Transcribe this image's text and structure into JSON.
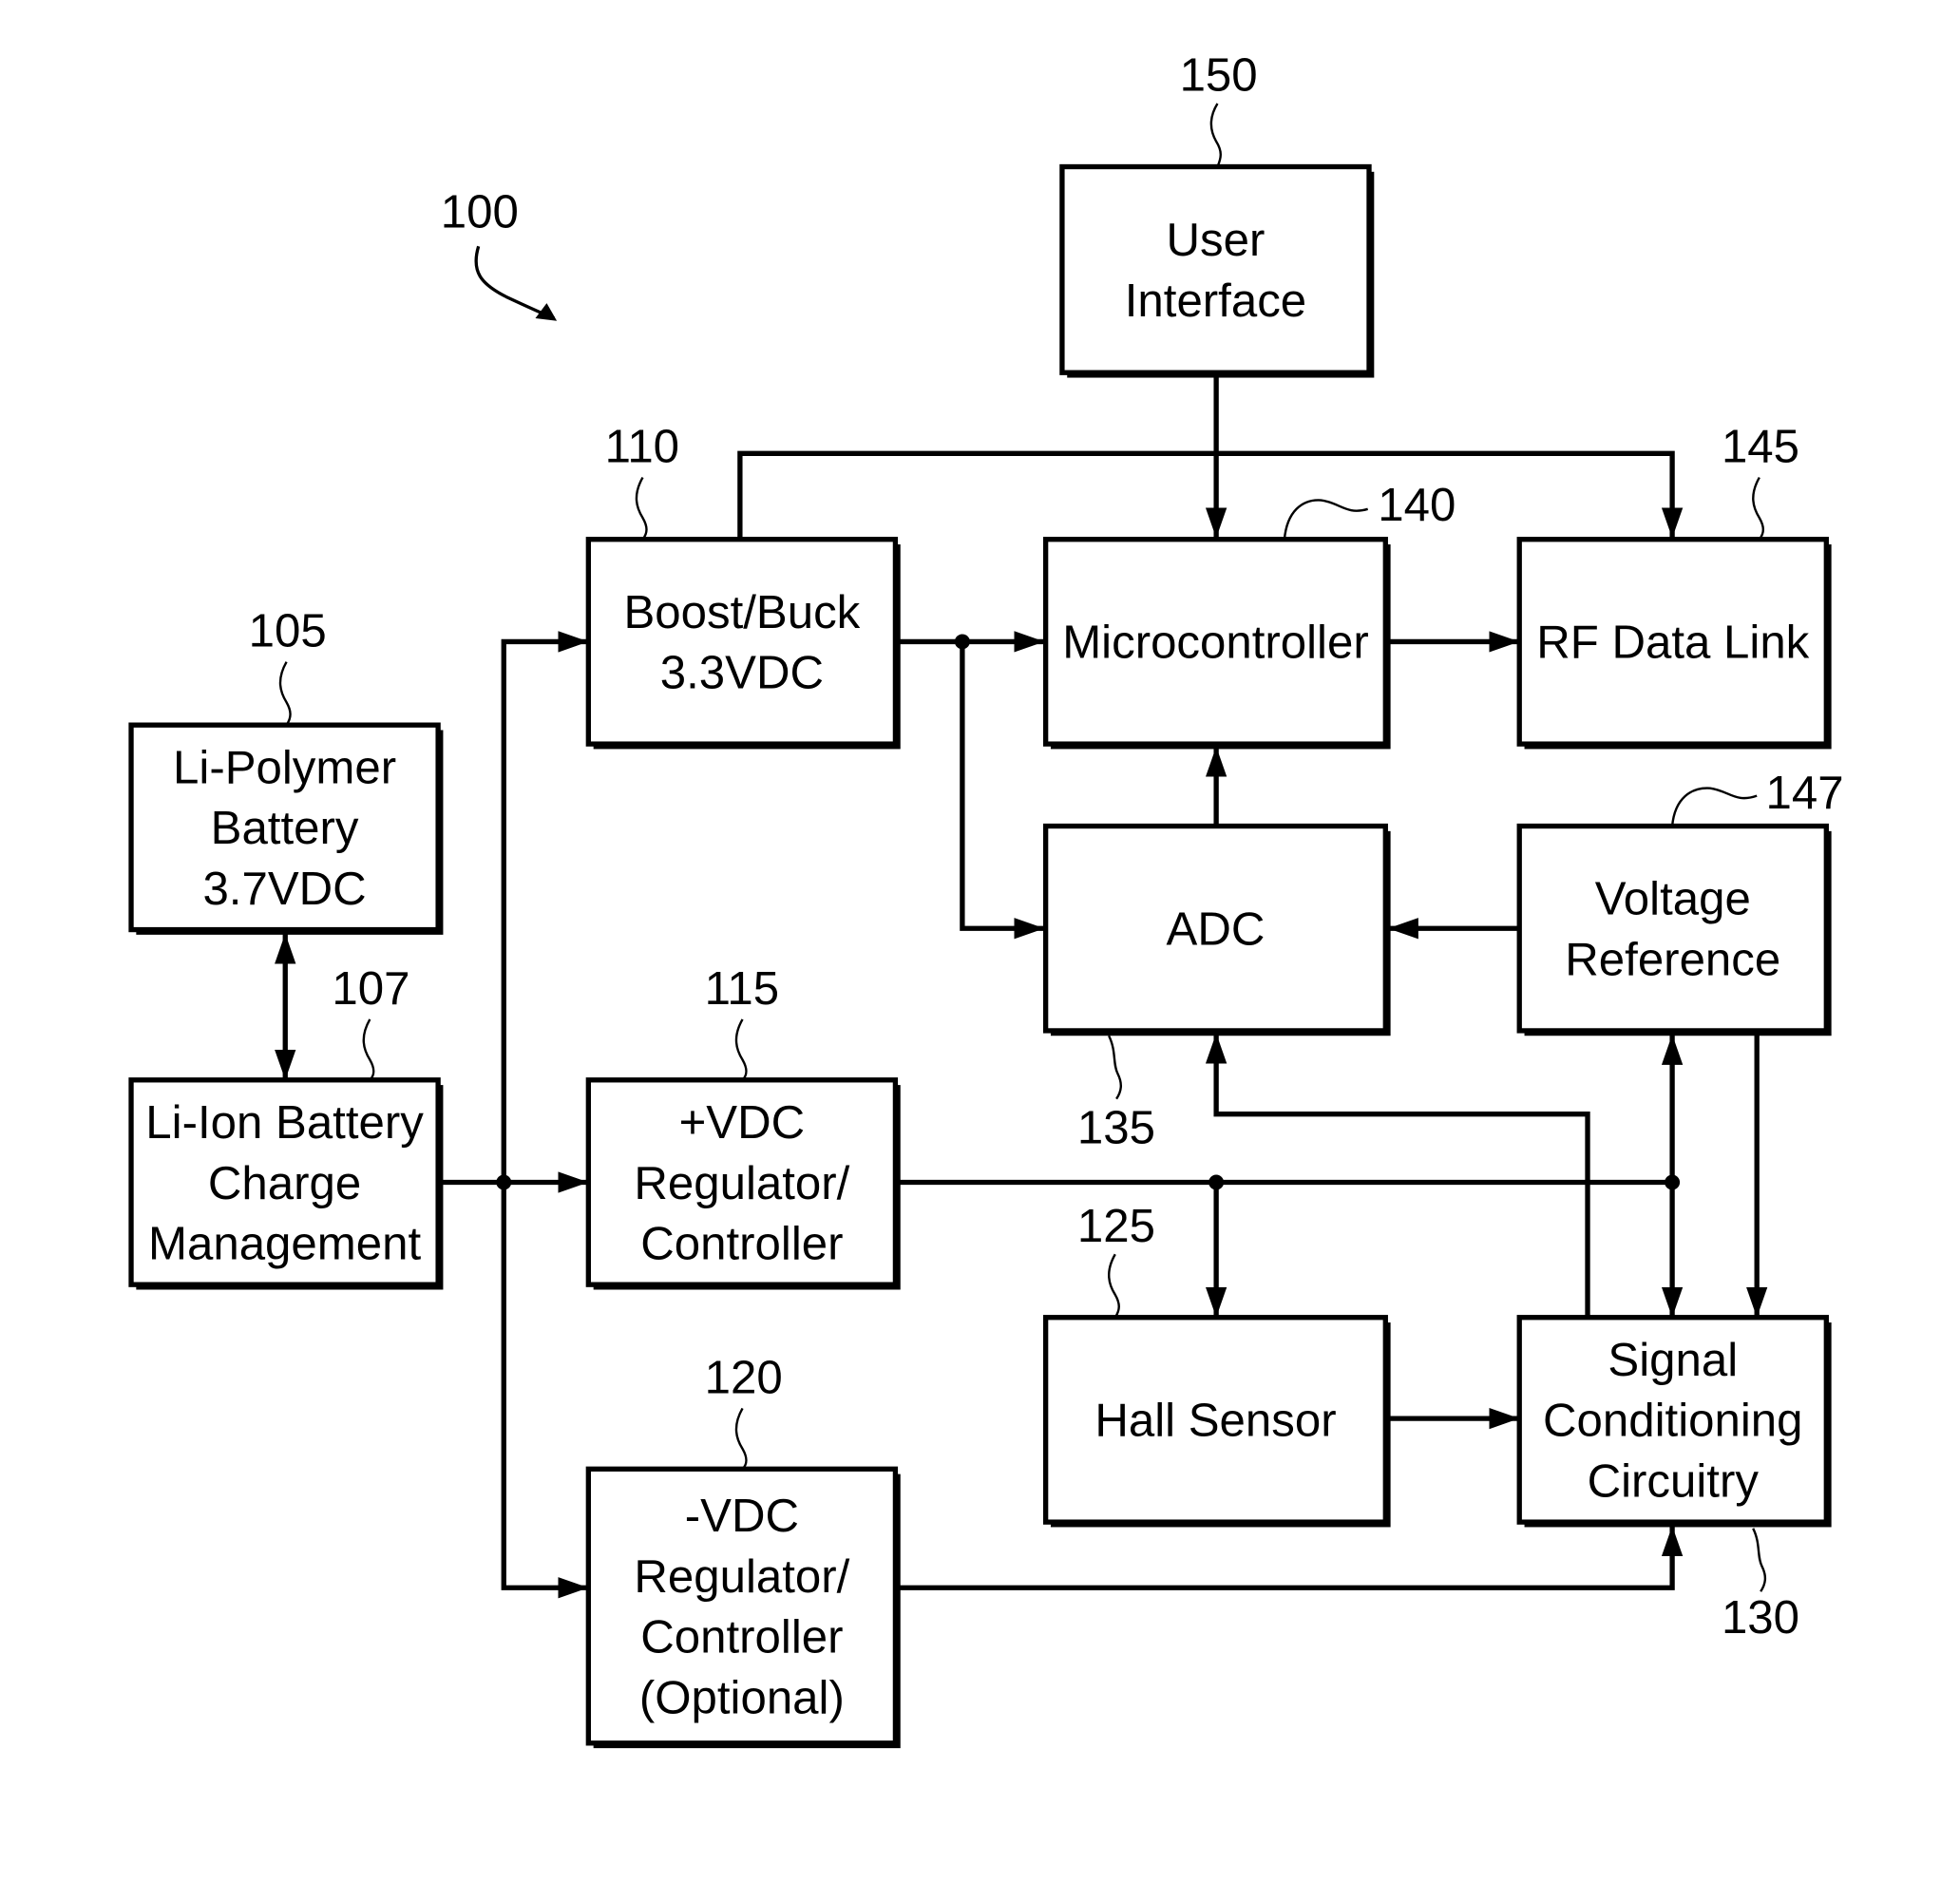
{
  "figure": {
    "ref": "100"
  },
  "blocks": {
    "user_interface": {
      "ref": "150",
      "lines": [
        "User",
        "Interface"
      ]
    },
    "boost_buck": {
      "ref": "110",
      "lines": [
        "Boost/Buck",
        "3.3VDC"
      ]
    },
    "microcontroller": {
      "ref": "140",
      "lines": [
        "Microcontroller"
      ]
    },
    "rf_data_link": {
      "ref": "145",
      "lines": [
        "RF Data Link"
      ]
    },
    "li_polymer": {
      "ref": "105",
      "lines": [
        "Li-Polymer",
        "Battery",
        "3.7VDC"
      ]
    },
    "adc": {
      "ref": "135",
      "lines": [
        "ADC"
      ]
    },
    "voltage_reference": {
      "ref": "147",
      "lines": [
        "Voltage",
        "Reference"
      ]
    },
    "li_ion_charge": {
      "ref": "107",
      "lines": [
        "Li-Ion Battery",
        "Charge",
        "Management"
      ]
    },
    "plus_vdc": {
      "ref": "115",
      "lines": [
        "+VDC",
        "Regulator/",
        "Controller"
      ]
    },
    "hall_sensor": {
      "ref": "125",
      "lines": [
        "Hall Sensor"
      ]
    },
    "signal_conditioning": {
      "ref": "130",
      "lines": [
        "Signal",
        "Conditioning",
        "Circuitry"
      ]
    },
    "minus_vdc": {
      "ref": "120",
      "lines": [
        "-VDC",
        "Regulator/",
        "Controller",
        "(Optional)"
      ]
    }
  },
  "connections": [
    {
      "from": "User Interface",
      "to": "Microcontroller",
      "type": "arrow"
    },
    {
      "from": "Boost/Buck 3.3VDC",
      "to": "RF Data Link",
      "type": "arrow"
    },
    {
      "from": "Boost/Buck 3.3VDC",
      "to": "Microcontroller",
      "type": "arrow"
    },
    {
      "from": "Boost/Buck 3.3VDC",
      "to": "ADC",
      "type": "arrow"
    },
    {
      "from": "Microcontroller",
      "to": "RF Data Link",
      "type": "arrow"
    },
    {
      "from": "ADC",
      "to": "Microcontroller",
      "type": "arrow"
    },
    {
      "from": "Voltage Reference",
      "to": "ADC",
      "type": "arrow"
    },
    {
      "from": "Li-Polymer Battery",
      "to": "Li-Ion Battery Charge Management",
      "type": "bidirectional"
    },
    {
      "from": "Li-Ion Battery Charge Management",
      "to": "Boost/Buck 3.3VDC",
      "type": "arrow"
    },
    {
      "from": "Li-Ion Battery Charge Management",
      "to": "+VDC Regulator/Controller",
      "type": "arrow"
    },
    {
      "from": "Li-Ion Battery Charge Management",
      "to": "-VDC Regulator/Controller",
      "type": "arrow"
    },
    {
      "from": "+VDC Regulator/Controller",
      "to": "Hall Sensor",
      "type": "arrow"
    },
    {
      "from": "Voltage Reference",
      "to": "Signal Conditioning Circuitry",
      "type": "bidirectional"
    },
    {
      "from": "Voltage Reference",
      "to": "Signal Conditioning Circuitry",
      "type": "arrow"
    },
    {
      "from": "Hall Sensor",
      "to": "Signal Conditioning Circuitry",
      "type": "arrow"
    },
    {
      "from": "Signal Conditioning Circuitry",
      "to": "ADC",
      "type": "arrow"
    },
    {
      "from": "-VDC Regulator/Controller",
      "to": "Signal Conditioning Circuitry",
      "type": "arrow"
    }
  ]
}
